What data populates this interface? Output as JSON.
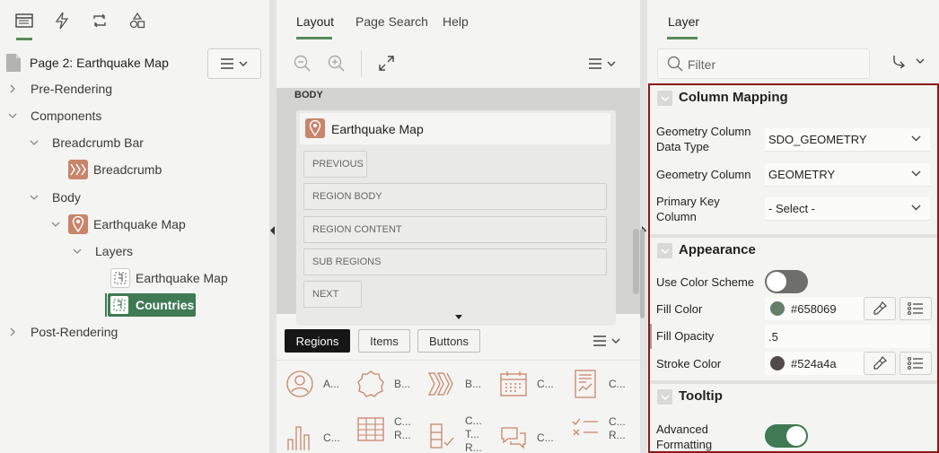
{
  "left": {
    "page_title": "Page 2: Earthquake Map",
    "tree": {
      "pre_rendering": "Pre-Rendering",
      "components": "Components",
      "breadcrumb_bar": "Breadcrumb Bar",
      "breadcrumb": "Breadcrumb",
      "body": "Body",
      "earthquake_map": "Earthquake Map",
      "layers": "Layers",
      "layer_earthquake_map": "Earthquake Map",
      "layer_countries": "Countries",
      "post_rendering": "Post-Rendering"
    }
  },
  "middle": {
    "tabs": [
      "Layout",
      "Page Search",
      "Help"
    ],
    "canvas": {
      "body_label": "BODY",
      "region_title": "Earthquake Map",
      "slots": [
        "PREVIOUS",
        "REGION BODY",
        "REGION CONTENT",
        "SUB REGIONS",
        "NEXT"
      ]
    },
    "gallery_tabs": [
      "Regions",
      "Items",
      "Buttons"
    ],
    "gallery_row1": [
      "A...",
      "B...",
      "B...",
      "C...",
      "C..."
    ],
    "gallery_row2": [
      "C...",
      "C...\nR...",
      "C...\nT...\nR...",
      "C...",
      "C...\nR..."
    ]
  },
  "right": {
    "tab": "Layer",
    "filter_placeholder": "Filter",
    "sections": {
      "column_mapping": "Column Mapping",
      "appearance": "Appearance",
      "tooltip": "Tooltip"
    },
    "props": {
      "geometry_type_label": "Geometry Column Data Type",
      "geometry_type_value": "SDO_GEOMETRY",
      "geometry_column_label": "Geometry Column",
      "geometry_column_value": "GEOMETRY",
      "pk_label": "Primary Key Column",
      "pk_value": "- Select -",
      "use_color_scheme_label": "Use Color Scheme",
      "use_color_scheme_on": false,
      "fill_color_label": "Fill Color",
      "fill_color_value": "#658069",
      "fill_opacity_label": "Fill Opacity",
      "fill_opacity_value": ".5",
      "stroke_color_label": "Stroke Color",
      "stroke_color_value": "#524a4a",
      "advanced_formatting_label": "Advanced Formatting",
      "advanced_formatting_on": true
    }
  },
  "colors": {
    "accent_green": "#3f7a55",
    "icon_orange": "#c8856b",
    "highlight_border": "#8b1a1a"
  }
}
